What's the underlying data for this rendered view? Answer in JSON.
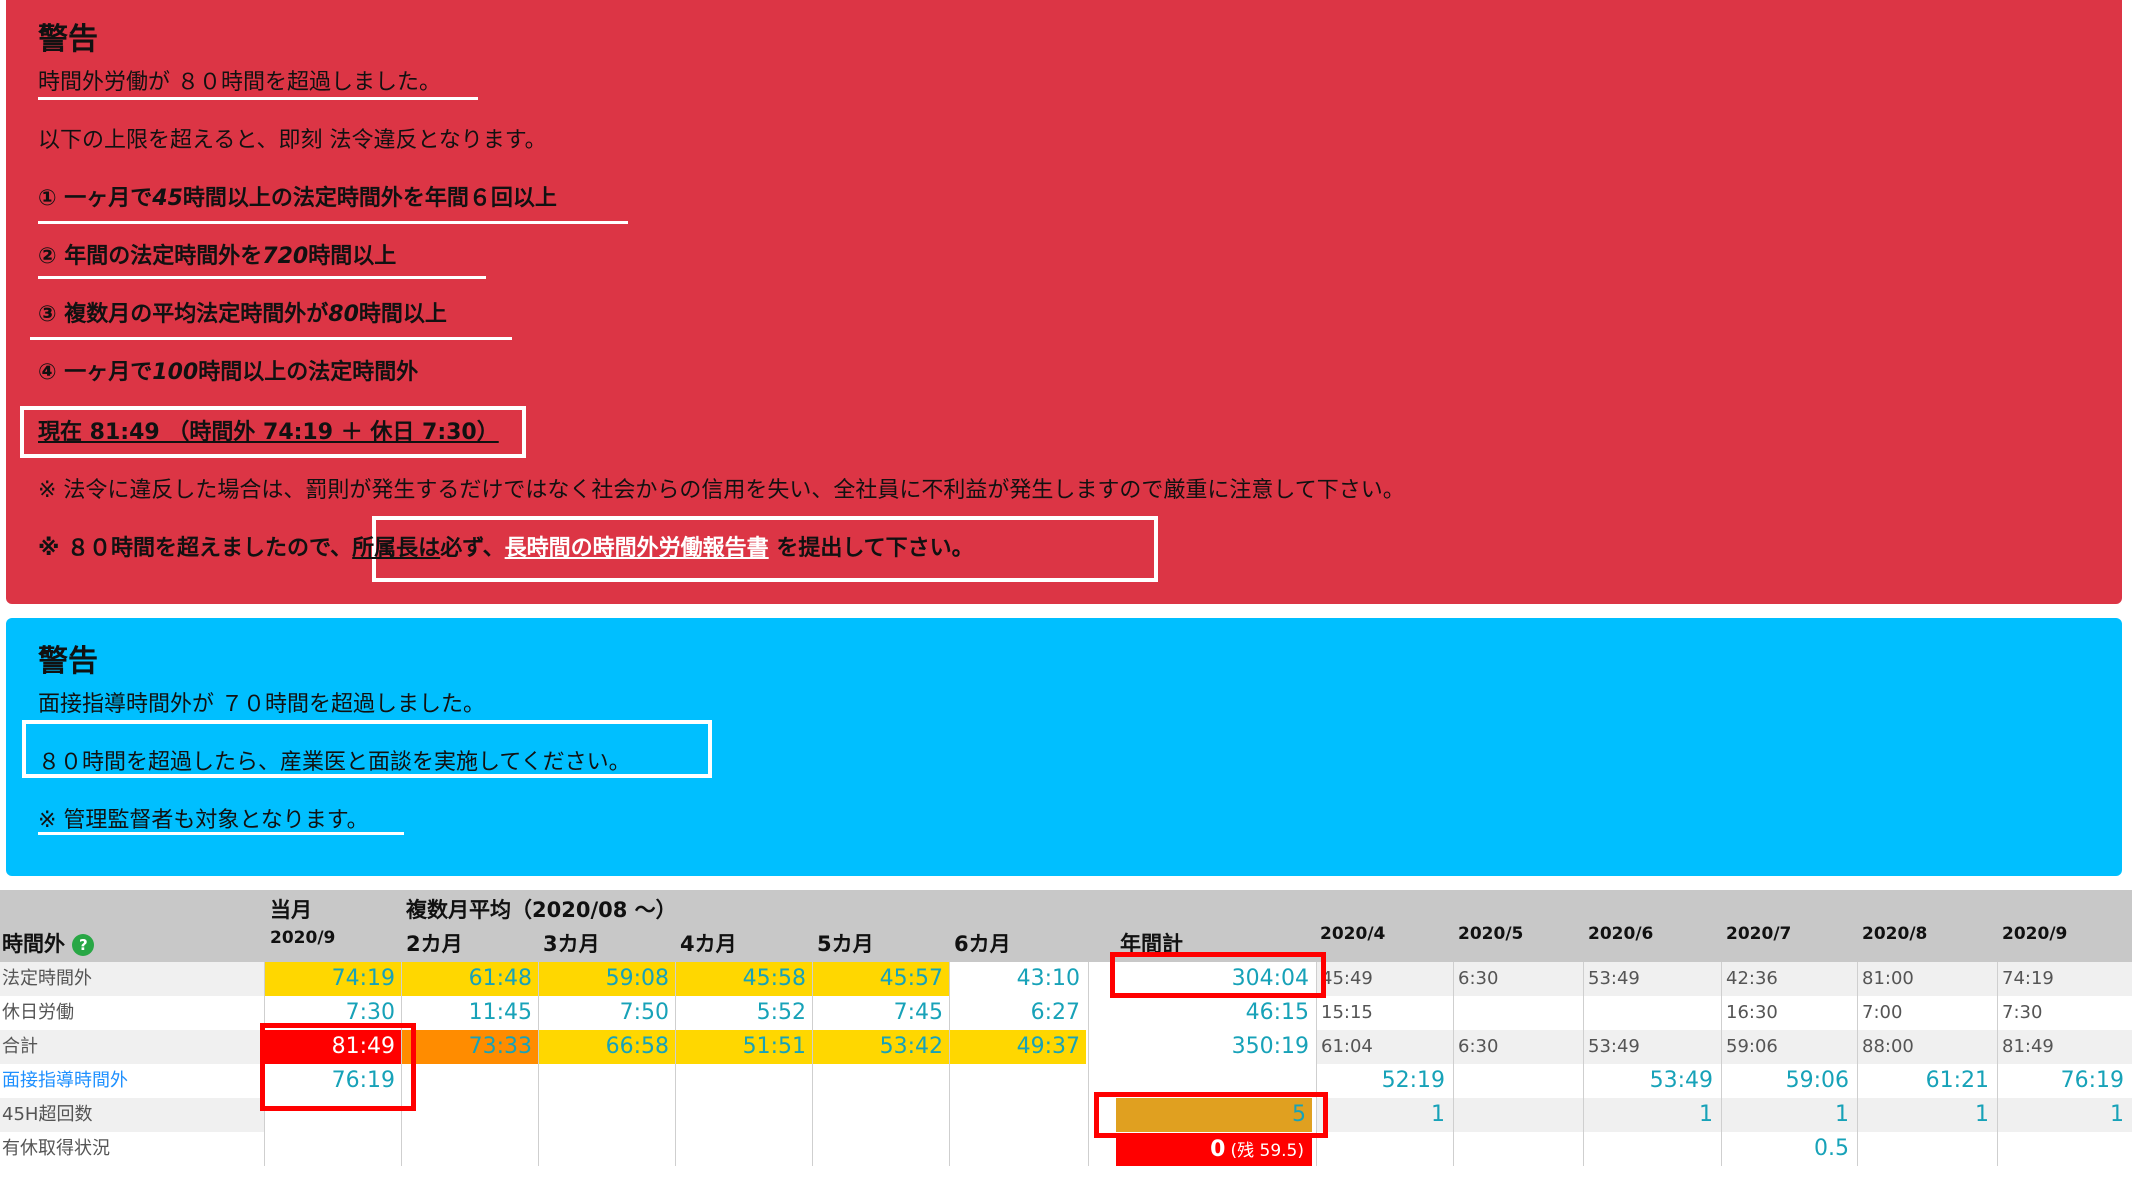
{
  "red_warning": {
    "title": "警告",
    "line1": "時間外労働が ８０時間を超過しました。",
    "line2": "以下の上限を超えると、即刻 法令違反となります。",
    "rule1_prefix": "① 一ヶ月で",
    "rule1_num": "45",
    "rule1_suffix": "時間以上の法定時間外を年間６回以上",
    "rule2_prefix": "② 年間の法定時間外を",
    "rule2_num": "720",
    "rule2_suffix": "時間以上",
    "rule3_prefix": "③ 複数月の平均法定時間外が",
    "rule3_num": "80",
    "rule3_suffix": "時間以上",
    "rule4_prefix": "④ 一ヶ月で",
    "rule4_num": "100",
    "rule4_suffix": "時間以上の法定時間外",
    "current": "現在 81:49 （時間外 74:19 ＋ 休日 7:30）",
    "note1": "※ 法令に違反した場合は、罰則が発生するだけではなく社会からの信用を失い、全社員に不利益が発生しますので厳重に注意して下さい。",
    "note2_prefix": "※ ８０時間を超えましたので、",
    "note2_manager": "所属長は",
    "note2_mid": "必ず、",
    "note2_link": "長時間の時間外労働報告書",
    "note2_suffix": " を提出して下さい。"
  },
  "blue_warning": {
    "title": "警告",
    "line1": "面接指導時間外が ７０時間を超過しました。",
    "line2": "８０時間を超過したら、産業医と面談を実施してください。",
    "line3": "※ 管理監督者も対象となります。"
  },
  "table": {
    "row_header": "時間外",
    "help_icon": "question-icon",
    "col_current": "当月",
    "col_current_month": "2020/9",
    "col_avg_group": "複数月平均（2020/08 ～）",
    "avg_cols": [
      "2カ月",
      "3カ月",
      "4カ月",
      "5カ月",
      "6カ月"
    ],
    "col_annual": "年間計",
    "months": [
      "2020/4",
      "2020/5",
      "2020/6",
      "2020/7",
      "2020/8",
      "2020/9"
    ],
    "row_labels": [
      "法定時間外",
      "休日労働",
      "合計",
      "面接指導時間外",
      "45H超回数",
      "有休取得状況"
    ],
    "rows": {
      "legal_overtime": {
        "current": "74:19",
        "avg": [
          "61:48",
          "59:08",
          "45:58",
          "45:57",
          "43:10"
        ],
        "annual": "304:04",
        "months": [
          "45:49",
          "6:30",
          "53:49",
          "42:36",
          "81:00",
          "74:19"
        ]
      },
      "holiday": {
        "current": "7:30",
        "avg": [
          "11:45",
          "7:50",
          "5:52",
          "7:45",
          "6:27"
        ],
        "annual": "46:15",
        "months": [
          "15:15",
          "",
          "",
          "16:30",
          "7:00",
          "7:30"
        ]
      },
      "total": {
        "current": "81:49",
        "avg": [
          "73:33",
          "66:58",
          "51:51",
          "53:42",
          "49:37"
        ],
        "annual": "350:19",
        "months": [
          "61:04",
          "6:30",
          "53:49",
          "59:06",
          "88:00",
          "81:49"
        ]
      },
      "interview": {
        "current": "76:19",
        "months": [
          "52:19",
          "",
          "53:49",
          "59:06",
          "61:21",
          "76:19"
        ]
      },
      "over45": {
        "annual": "5",
        "months": [
          "1",
          "",
          "1",
          "1",
          "1",
          "1"
        ]
      },
      "paid_leave": {
        "annual": "0",
        "annual_remain": "(残 59.5)",
        "months": [
          "",
          "",
          "",
          "0.5",
          "",
          ""
        ]
      }
    }
  },
  "colors": {
    "red_panel": "#dc3545",
    "blue_panel": "#00bfff",
    "yellow": "#ffd700",
    "orange": "#ff8c00",
    "alert_red": "#ff0000",
    "value_teal": "#17a2b8"
  }
}
